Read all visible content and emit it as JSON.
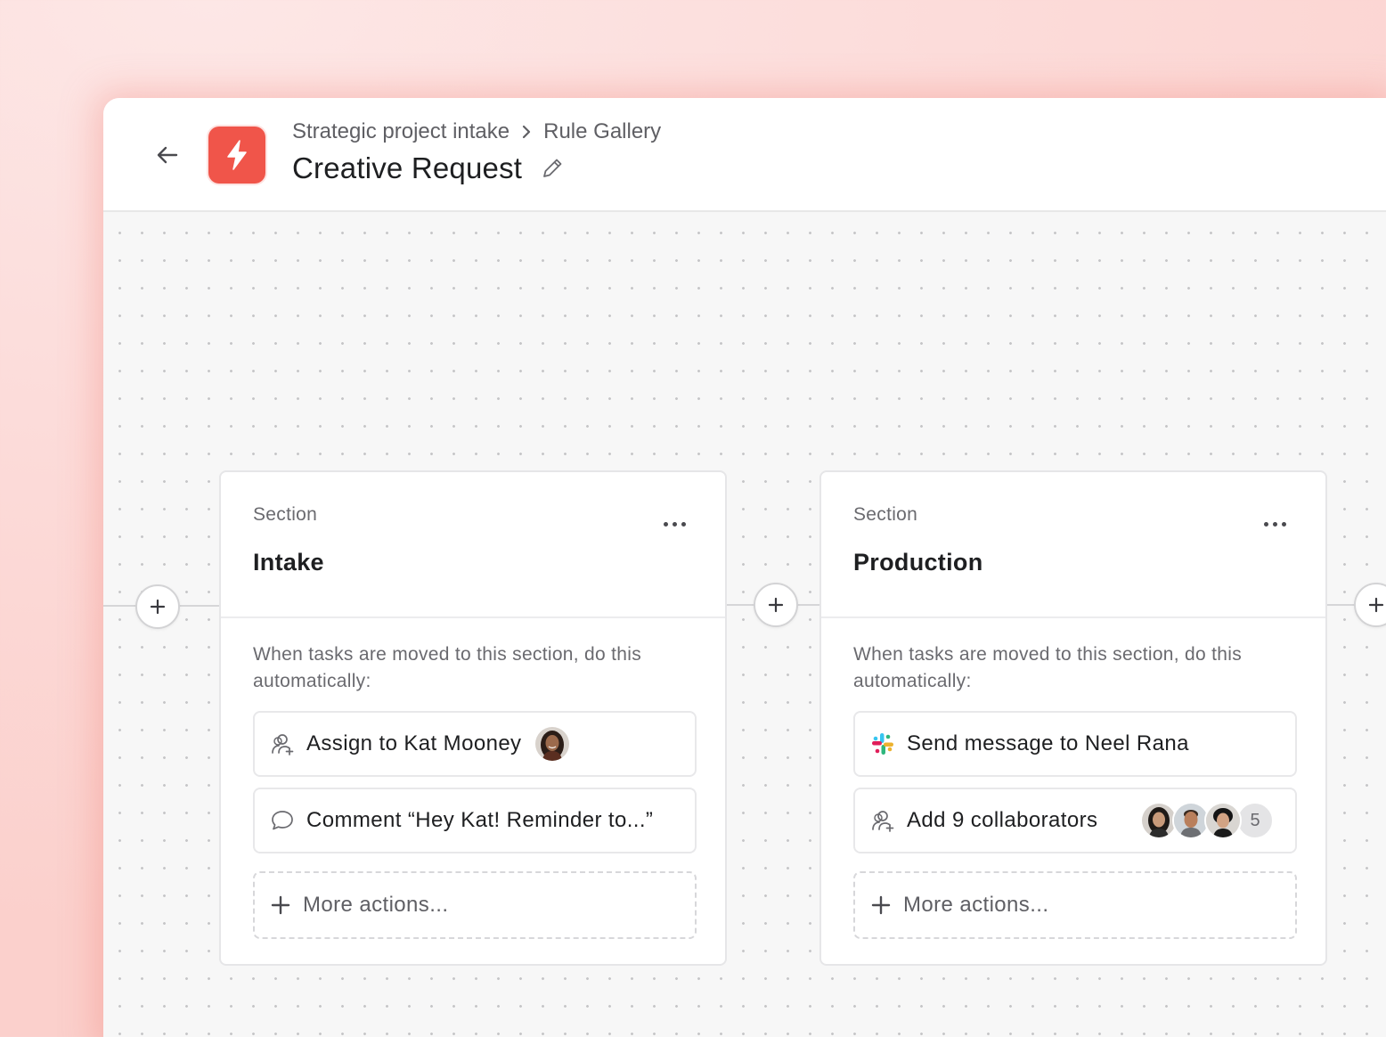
{
  "header": {
    "breadcrumb": [
      "Strategic project intake",
      "Rule Gallery"
    ],
    "title": "Creative Request",
    "accent_color": "#f0554a",
    "icons": {
      "back": "arrow-left-icon",
      "app": "lightning-bolt-icon",
      "separator": "chevron-right-icon",
      "edit": "pencil-icon"
    }
  },
  "sections": [
    {
      "label": "Section",
      "name": "Intake",
      "description": "When tasks are moved to this section, do this automatically:",
      "actions": [
        {
          "icon": "assign-user-icon",
          "label": "Assign to Kat Mooney",
          "avatar": "kat-mooney-avatar"
        },
        {
          "icon": "comment-bubble-icon",
          "label": "Comment “Hey Kat! Reminder to...”"
        }
      ],
      "more_label": "More actions..."
    },
    {
      "label": "Section",
      "name": "Production",
      "description": "When tasks are moved to this section, do this automatically:",
      "actions": [
        {
          "icon": "slack-icon",
          "label": "Send message to Neel Rana"
        },
        {
          "icon": "add-collaborators-icon",
          "label": "Add 9 collaborators",
          "extra_count": "5"
        }
      ],
      "more_label": "More actions..."
    }
  ]
}
